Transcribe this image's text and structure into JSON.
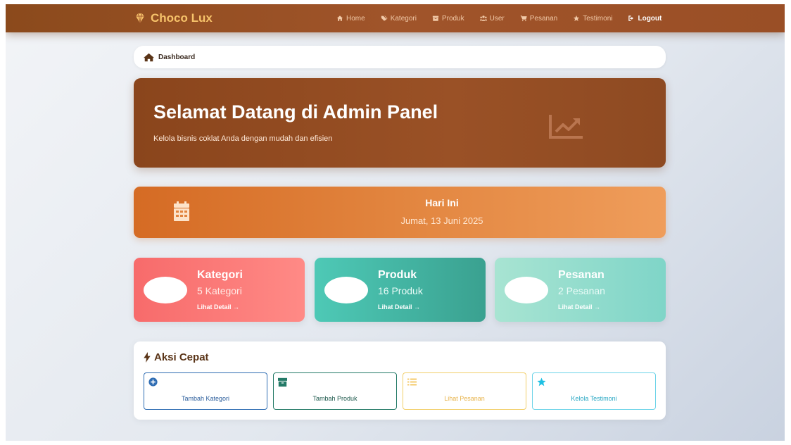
{
  "navbar": {
    "brand": "Choco Lux",
    "items": [
      {
        "label": "Home",
        "icon": "home-icon"
      },
      {
        "label": "Kategori",
        "icon": "tags-icon"
      },
      {
        "label": "Produk",
        "icon": "box-icon"
      },
      {
        "label": "User",
        "icon": "users-icon"
      },
      {
        "label": "Pesanan",
        "icon": "cart-icon"
      },
      {
        "label": "Testimoni",
        "icon": "star-icon"
      },
      {
        "label": "Logout",
        "icon": "logout-icon"
      }
    ]
  },
  "breadcrumb": {
    "label": "Dashboard",
    "icon": "home-icon"
  },
  "hero": {
    "title": "Selamat Datang di Admin Panel",
    "subtitle": "Kelola bisnis coklat Anda dengan mudah dan efisien",
    "icon": "chart-line-icon"
  },
  "today": {
    "title": "Hari Ini",
    "date": "Jumat, 13 Juni 2025",
    "icon": "calendar-icon"
  },
  "stats": [
    {
      "title": "Kategori",
      "count": "5 Kategori",
      "link": "Lihat Detail →"
    },
    {
      "title": "Produk",
      "count": "16 Produk",
      "link": "Lihat Detail →"
    },
    {
      "title": "Pesanan",
      "count": "2 Pesanan",
      "link": "Lihat Detail →"
    }
  ],
  "quick_actions": {
    "title": "Aksi Cepat",
    "items": [
      {
        "label": "Tambah Kategori",
        "icon": "plus-circle-icon"
      },
      {
        "label": "Tambah Produk",
        "icon": "box-icon"
      },
      {
        "label": "Lihat Pesanan",
        "icon": "list-icon"
      },
      {
        "label": "Kelola Testimoni",
        "icon": "star-icon"
      }
    ]
  },
  "colors": {
    "brand": "#f7c36a",
    "navbar": "#9a4f26",
    "hero": "#8e4a22",
    "today": "#e2853f",
    "kategori": "#f76b6b",
    "produk": "#3aa190",
    "pesanan": "#7fd5c8"
  }
}
